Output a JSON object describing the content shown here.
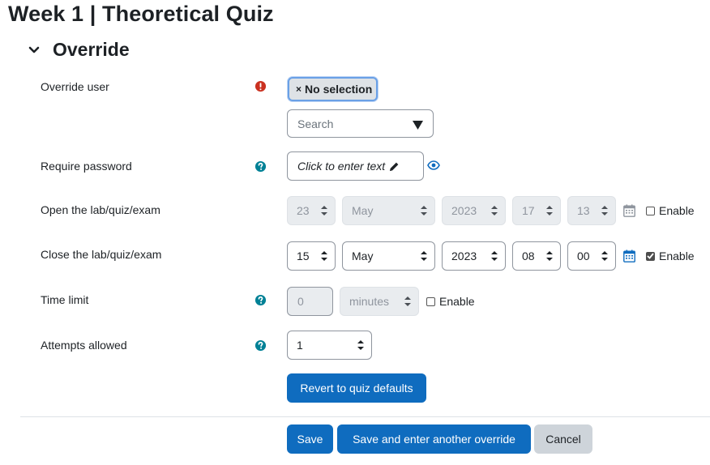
{
  "page": {
    "title": "Week 1 | Theoretical Quiz"
  },
  "section": {
    "title": "Override"
  },
  "override_user": {
    "label": "Override user",
    "selected_tag": "No selection",
    "remove_glyph": "×",
    "search_placeholder": "Search",
    "required_icon": "exclamation-circle-icon"
  },
  "password": {
    "label": "Require password",
    "placeholder": "Click to enter text",
    "help_icon": "question-circle-icon"
  },
  "open": {
    "label": "Open the lab/quiz/exam",
    "day": "23",
    "month": "May",
    "year": "2023",
    "hour": "17",
    "minute": "13",
    "enable_label": "Enable",
    "enabled": false
  },
  "close": {
    "label": "Close the lab/quiz/exam",
    "day": "15",
    "month": "May",
    "year": "2023",
    "hour": "08",
    "minute": "00",
    "enable_label": "Enable",
    "enabled": true
  },
  "time_limit": {
    "label": "Time limit",
    "value": "0",
    "unit": "minutes",
    "enable_label": "Enable",
    "enabled": false
  },
  "attempts": {
    "label": "Attempts allowed",
    "value": "1"
  },
  "buttons": {
    "revert": "Revert to quiz defaults",
    "save": "Save",
    "save_another": "Save and enter another override",
    "cancel": "Cancel"
  },
  "colors": {
    "primary": "#0f6cbf",
    "danger": "#ca3120",
    "help": "#008196",
    "secondary": "#ced4da"
  }
}
